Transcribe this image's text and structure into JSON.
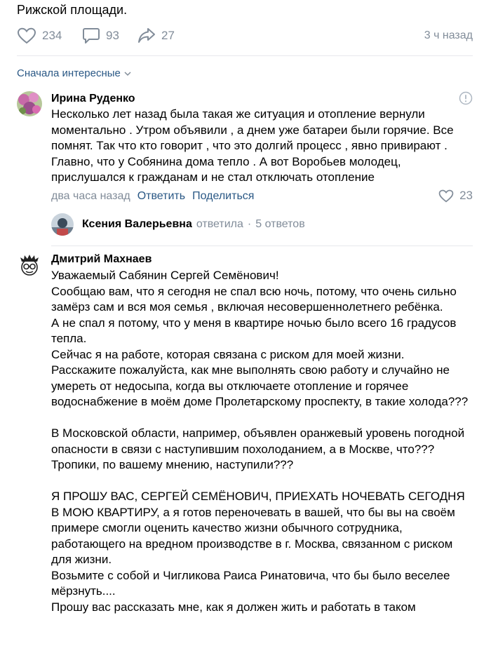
{
  "post": {
    "text_tail": "Рижской площади.",
    "likes": "234",
    "comments": "93",
    "shares": "27",
    "time": "3 ч назад"
  },
  "sort": {
    "label": "Сначала интересные"
  },
  "comments": [
    {
      "author": "Ирина Руденко",
      "text": "Несколько лет назад была такая же ситуация и отопление вернули моментально . Утром объявили , а днем уже батареи были горячие. Все помнят. Так что кто говорит , что это долгий процесс , явно привирают . Главно, что у Собянина дома тепло . А вот Воробьев молодец, прислушался к гражданам и не стал отключать отопление",
      "time": "два часа назад",
      "reply_label": "Ответить",
      "share_label": "Поделиться",
      "likes": "23",
      "reply_author": "Ксения Валерьевна",
      "reply_action": "ответила",
      "reply_count": "5 ответов"
    },
    {
      "author": "Дмитрий Махнаев",
      "text": "Уважаемый Сабянин Сергей Семёнович!\nСообщаю вам, что я сегодня не спал всю ночь, потому, что очень сильно замёрз сам и вся моя семья , включая несовершеннолетнего ребёнка.\nА не спал я потому, что у меня в квартире ночью было всего 16 градусов тепла.\nСейчас я на работе, которая связана с риском для моей жизни.\nРасскажите пожалуйста, как мне выполнять свою работу и случайно не умереть от недосыпа, когда вы отключаете отопление и горячее водоснабжение в моём доме Пролетарскому проспекту, в такие холода???\n\nВ Московской области, например, объявлен оранжевый уровень погодной опасности в связи с наступившим похолоданием, а в Москве, что??? Тропики, по вашему мнению, наступили???\n\nЯ ПРОШУ ВАС, СЕРГЕЙ СЕМЁНОВИЧ, ПРИЕХАТЬ НОЧЕВАТЬ СЕГОДНЯ В МОЮ КВАРТИРУ, а я готов переночевать в вашей, что бы вы на своём примере смогли оценить качество жизни обычного сотрудника, работающего на вредном производстве в г. Москва, связанном с риском для жизни.\nВозьмите с собой и Чигликова Раиса Ринатовича, что бы было веселее мёрзнуть....\nПрошу вас рассказать мне, как я должен жить и работать в таком"
    }
  ],
  "colors": {
    "link": "#2a5885",
    "muted": "#818c99",
    "divider": "#e7e8ec"
  },
  "icons": [
    "heart-icon",
    "comment-icon",
    "share-icon",
    "chevron-down-icon",
    "report-icon"
  ]
}
